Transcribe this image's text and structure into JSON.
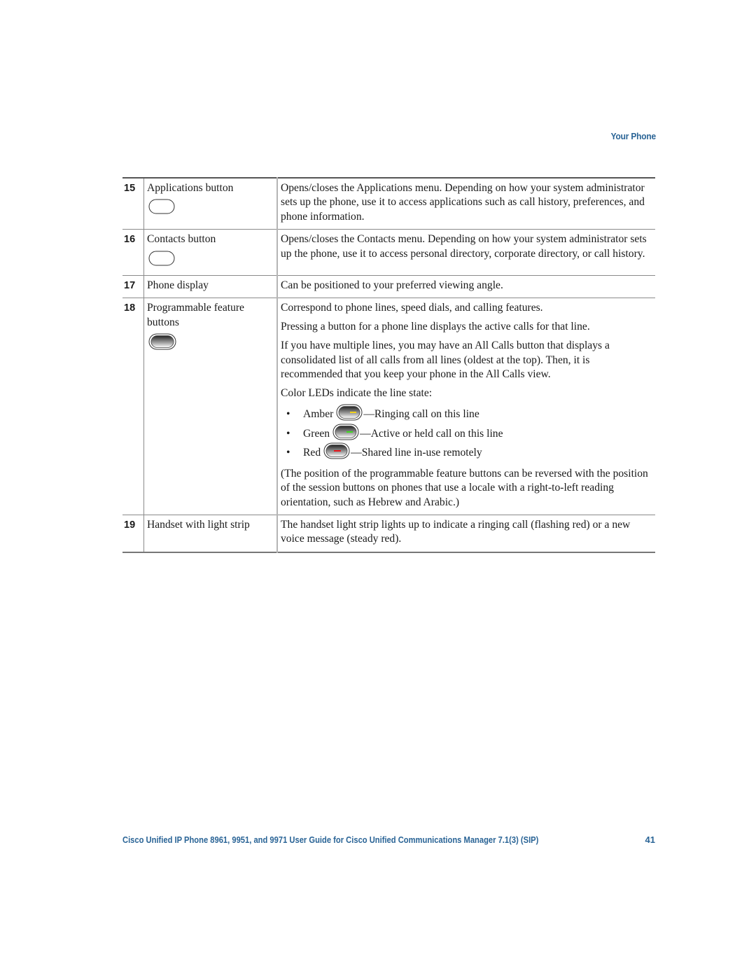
{
  "header": {
    "section_title": "Your Phone"
  },
  "table": {
    "rows": [
      {
        "number": "15",
        "name": "Applications button",
        "icon": "plain-oval-button-icon",
        "description": [
          "Opens/closes the Applications menu. Depending on how your system administrator sets up the phone, use it to access applications such as call history, preferences, and phone information."
        ]
      },
      {
        "number": "16",
        "name": "Contacts button",
        "icon": "plain-oval-button-icon",
        "description": [
          "Opens/closes the Contacts menu. Depending on how your system administrator sets up the phone, use it to access personal directory, corporate directory, or call history."
        ]
      },
      {
        "number": "17",
        "name": "Phone display",
        "description": [
          "Can be positioned to your preferred viewing angle."
        ]
      },
      {
        "number": "18",
        "name": "Programmable feature buttons",
        "icon": "shaded-line-button-icon",
        "description": [
          "Correspond to phone lines, speed dials, and calling features.",
          "Pressing a button for a phone line displays the active calls for that line.",
          "If you have multiple lines, you may have an All Calls button that displays a consolidated list of all calls from all lines (oldest at the top). Then, it is recommended that you keep your phone in the All Calls view.",
          "Color LEDs indicate the line state:"
        ],
        "led_states": [
          {
            "label": "Amber",
            "text": "—Ringing call on this line",
            "color": "#f2d21b"
          },
          {
            "label": "Green",
            "text": "—Active or held call on this line",
            "color": "#3ddc1f"
          },
          {
            "label": "Red",
            "text": "—Shared line in-use remotely",
            "color": "#e8141b"
          }
        ],
        "note": "(The position of the programmable feature buttons can be reversed with the position of the session buttons on phones that use a locale with a right-to-left reading orientation, such as Hebrew and Arabic.)"
      },
      {
        "number": "19",
        "name": "Handset with light strip",
        "description": [
          "The handset light strip lights up to indicate a ringing call (flashing red) or a new voice message (steady red)."
        ]
      }
    ]
  },
  "footer": {
    "title": "Cisco Unified IP Phone 8961, 9951, and 9971 User Guide for Cisco Unified Communications Manager 7.1(3) (SIP)",
    "page_number": "41"
  },
  "colors": {
    "accent": "#2a6496"
  }
}
